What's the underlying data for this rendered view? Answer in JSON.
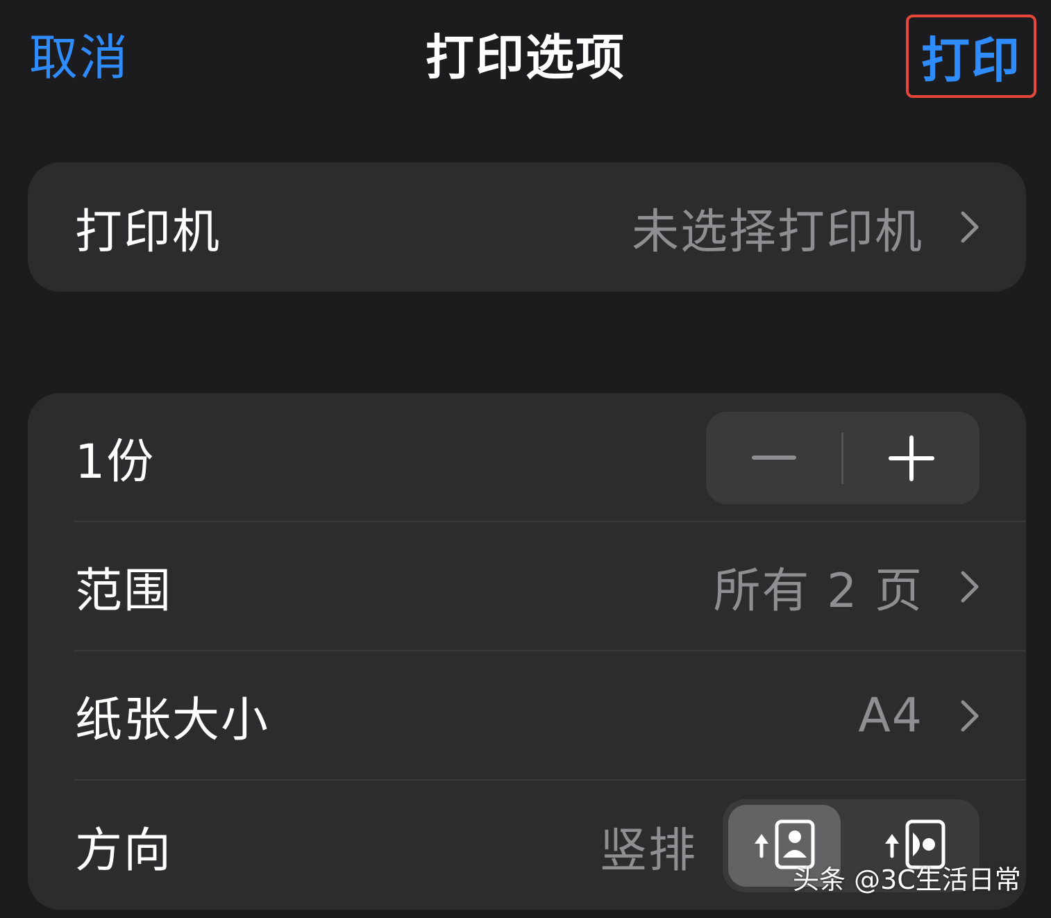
{
  "nav": {
    "cancel_label": "取消",
    "title": "打印选项",
    "print_label": "打印"
  },
  "printer": {
    "label": "打印机",
    "value": "未选择打印机"
  },
  "copies": {
    "label": "1份",
    "count": 1
  },
  "range": {
    "label": "范围",
    "value": "所有 2 页"
  },
  "paper_size": {
    "label": "纸张大小",
    "value": "A4"
  },
  "orientation": {
    "label": "方向",
    "value": "竖排",
    "options": [
      "portrait-icon",
      "landscape-icon"
    ],
    "selected": "portrait-icon"
  },
  "watermark": {
    "text": "头条 @3C生活日常"
  },
  "colors": {
    "background": "#1c1c1e",
    "card": "#2c2c2e",
    "accent": "#2f8cff",
    "secondary_text": "#8e8e93",
    "highlight_border": "#e5483a"
  }
}
